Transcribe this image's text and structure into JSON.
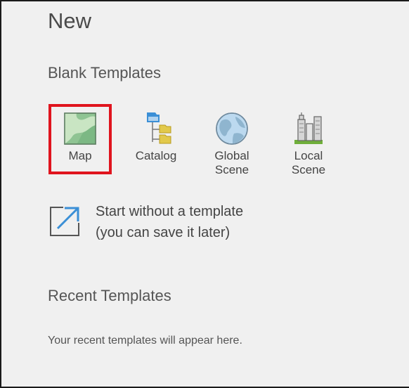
{
  "page": {
    "title": "New"
  },
  "blank_templates": {
    "heading": "Blank Templates",
    "items": [
      {
        "label": "Map",
        "icon": "map-icon",
        "selected": true
      },
      {
        "label": "Catalog",
        "icon": "catalog-icon"
      },
      {
        "label": "Global\nScene",
        "icon": "globe-icon"
      },
      {
        "label": "Local\nScene",
        "icon": "buildings-icon"
      }
    ]
  },
  "start_without_template": {
    "line1": "Start without a template",
    "line2": "(you can save it later)",
    "icon": "open-external-arrow-icon"
  },
  "recent_templates": {
    "heading": "Recent Templates",
    "empty_text": "Your recent templates will appear here."
  },
  "colors": {
    "selection_outline": "#e0141e",
    "accent_blue": "#3b8fd6"
  }
}
